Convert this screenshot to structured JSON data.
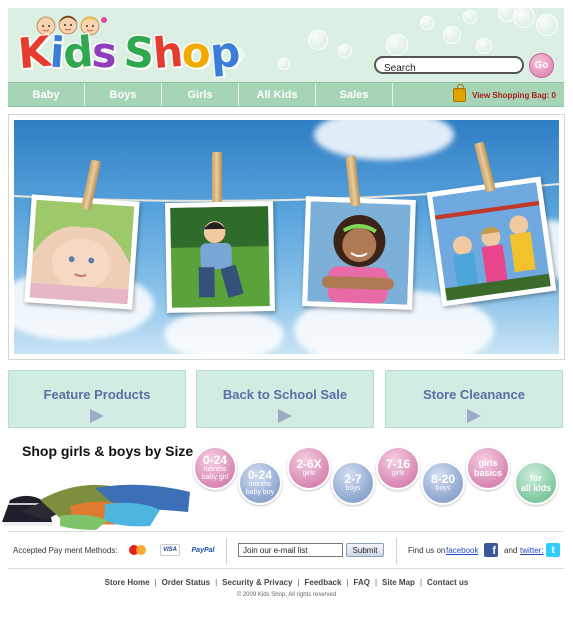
{
  "logo": {
    "letters": [
      {
        "ch": "K",
        "color": "#e63c2f"
      },
      {
        "ch": "i",
        "color": "#3a7fd5"
      },
      {
        "ch": "d",
        "color": "#2fa84f"
      },
      {
        "ch": "s",
        "color": "#8e3fbf"
      },
      {
        "ch": " ",
        "color": "#ffffff"
      },
      {
        "ch": "S",
        "color": "#2fa84f"
      },
      {
        "ch": "h",
        "color": "#e63c2f"
      },
      {
        "ch": "o",
        "color": "#f2a900"
      },
      {
        "ch": "p",
        "color": "#3a7fd5"
      }
    ]
  },
  "search": {
    "placeholder": "Search",
    "go_label": "Go"
  },
  "nav": {
    "items": [
      "Baby",
      "Boys",
      "Girls",
      "All Kids",
      "Sales"
    ],
    "bag_label": "View Shopping Bag: 0"
  },
  "promos": [
    "Feature Products",
    "Back to School Sale",
    "Store Cleanance"
  ],
  "sizes": {
    "title": "Shop girls & boys by Size",
    "buttons": [
      {
        "main": "0-24",
        "sub": "months",
        "sub2": "baby girl",
        "color": "pink"
      },
      {
        "main": "0-24",
        "sub": "months",
        "sub2": "baby boy",
        "color": "blue"
      },
      {
        "main": "2-6X",
        "sub": "girls",
        "sub2": "",
        "color": "pink"
      },
      {
        "main": "2-7",
        "sub": "boys",
        "sub2": "",
        "color": "blue"
      },
      {
        "main": "7-16",
        "sub": "girls",
        "sub2": "",
        "color": "pink"
      },
      {
        "main": "8-20",
        "sub": "boys",
        "sub2": "",
        "color": "blue"
      },
      {
        "main": "girls",
        "sub": "basics",
        "sub2": "",
        "color": "pink",
        "style": "word"
      },
      {
        "main": "for",
        "sub": "all kids",
        "sub2": "",
        "color": "green",
        "style": "word"
      }
    ]
  },
  "footer": {
    "pay_label": "Accepted Pay ment Methods:",
    "visa": "VISA",
    "paypal": "PayPal",
    "email_placeholder": "Join our e-mail list",
    "submit_label": "Submit",
    "find_us": "Find us on",
    "facebook": "facebook",
    "and": "and",
    "twitter": "twitter:",
    "links": [
      "Store Home",
      "Order Status",
      "Security & Privacy",
      "Feedback",
      "FAQ",
      "Site Map",
      "Contact us"
    ],
    "copyright": "© 2009 Kids Shop. All rights reserved"
  },
  "colors": {
    "accent": "#a6d4b6",
    "header_bg": "#dcefe3",
    "promo_text": "#5a6ea7"
  }
}
